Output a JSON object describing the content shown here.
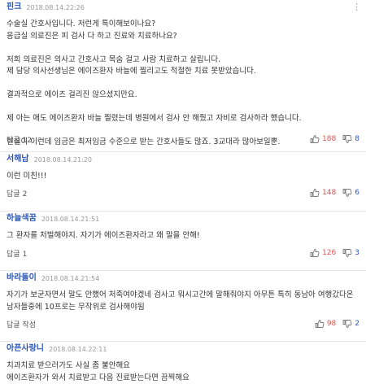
{
  "comments": [
    {
      "author": "핀크",
      "date": "2018.08.14.22:26",
      "more": "⋮",
      "lines": [
        "수술실 간호사입니다. 저런게 특이해보이나요?",
        "응급실 의료진은 피 검사 다 하고 진료와 치료하나요?",
        "",
        "저희 의료진은 의사고 간호사고 목숨 걸고 사람 치료하고 살립니다.",
        "제 담당 의사선생님은 에이즈환자 바늘에 찔리고도 적절한 치료 못받았습니다.",
        "",
        "결과적으로 에이즈 걸리진 않으셨지만요.",
        "",
        "제 아는 애도 에이즈환자 바늘 찔렸는데 병원에서 검사 안 해줬고 자비로 검사하라 했습니다.",
        "",
        "현실이 이런데 임금은 최저임금 수준으로 받는 간호사들도 많죠. 3교대라 많아보일뿐."
      ],
      "reply_label": "답글",
      "reply_count": "12",
      "likes": "188",
      "dislikes": "8"
    },
    {
      "author": "서해남",
      "date": "2018.08.14.21:20",
      "lines": [
        "이런 미친!!!"
      ],
      "reply_label": "답글",
      "reply_count": "2",
      "likes": "148",
      "dislikes": "6"
    },
    {
      "author": "하늘색꿈",
      "date": "2018.08.14.21:51",
      "lines": [
        "그 환자를 처벌해야지. 자기가 에이즈환자라고 왜 말을 안해!"
      ],
      "reply_label": "답글",
      "reply_count": "1",
      "likes": "126",
      "dislikes": "3"
    },
    {
      "author": "바라돌이",
      "date": "2018.08.14.21:54",
      "lines": [
        "자기가 보균자면서 말도 안했어 처죽여야겠네 검사고 뭐시고간에 말해줘야지 아무튼 특히 동남아 여행갔다온",
        "남자들중에 10프로는 무작위로 검사해야됨"
      ],
      "reply_label": "답글 작성",
      "reply_count": "",
      "likes": "98",
      "dislikes": "2"
    },
    {
      "author": "아픈사랑니",
      "date": "2018.08.14.22:11",
      "lines": [
        "치과치료 받으러가도 사실 좀 불안해요",
        "에이즈환자가 와서 치료받고 다음 진료받는다면 끔찍해요"
      ]
    }
  ],
  "colors": {
    "author": "#2c57b5",
    "like": "#e05252",
    "dislike": "#2c57b5"
  },
  "icons": {
    "like": "thumb-up-icon",
    "dislike": "thumb-down-icon",
    "more": "more-vertical-icon"
  }
}
